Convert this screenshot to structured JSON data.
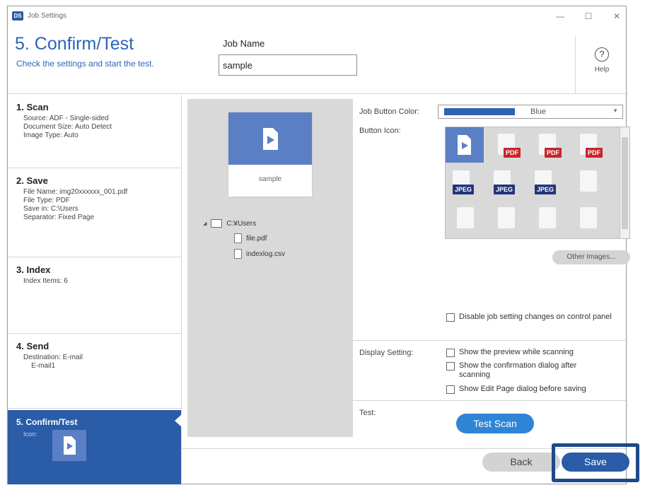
{
  "window": {
    "app_icon_text": "DS",
    "title": "Job Settings",
    "minimize": "—",
    "maximize": "☐",
    "close": "✕"
  },
  "header": {
    "step_title": "5. Confirm/Test",
    "step_subtitle": "Check the settings and start the test.",
    "job_name_label": "Job Name",
    "job_name_value": "sample",
    "help_icon": "?",
    "help_label": "Help"
  },
  "nav": {
    "items": [
      {
        "title": "1. Scan",
        "detail": "Source: ADF - Single-sided\nDocument Size: Auto Detect\nImage Type: Auto"
      },
      {
        "title": "2. Save",
        "detail": "File Name: img20xxxxxx_001.pdf\nFile Type: PDF\nSave in: C:\\Users\nSeparator: Fixed Page"
      },
      {
        "title": "3. Index",
        "detail": "Index Items: 6"
      },
      {
        "title": "4. Send",
        "detail": "Destination: E-mail\n    E-mail1"
      },
      {
        "title": "5. Confirm/Test",
        "detail": "Icon:"
      }
    ],
    "active_index": 4
  },
  "preview": {
    "job_tile_label": "sample",
    "tree": {
      "expander": "◢",
      "folder": "C:¥Users",
      "files": [
        "file.pdf",
        "indexlog.csv"
      ]
    }
  },
  "settings": {
    "job_button_color_label": "Job Button Color:",
    "job_button_color_value": "Blue",
    "job_button_color_hex": "#2f63b3",
    "button_icon_label": "Button Icon:",
    "icons": [
      {
        "icon": "play-document-icon",
        "badge": ""
      },
      {
        "icon": "play-document-icon",
        "badge": "PDF"
      },
      {
        "icon": "play-document-icon",
        "badge": "PDF"
      },
      {
        "icon": "play-document-icon",
        "badge": "PDF"
      },
      {
        "icon": "play-document-icon",
        "badge": "JPEG"
      },
      {
        "icon": "play-document-icon",
        "badge": "JPEG"
      },
      {
        "icon": "play-document-icon",
        "badge": "JPEG"
      },
      {
        "icon": "play-document-icon",
        "badge": ""
      }
    ],
    "other_images_label": "Other Images...",
    "disable_changes_label": "Disable job setting changes on control panel",
    "display_setting_label": "Display Setting:",
    "display_options": [
      "Show the preview while scanning",
      "Show the confirmation dialog after scanning",
      "Show Edit Page dialog before saving"
    ],
    "test_label": "Test:",
    "test_scan_label": "Test Scan"
  },
  "footer": {
    "back_label": "Back",
    "save_label": "Save"
  },
  "colors": {
    "accent": "#2a5ca8",
    "test_button": "#2e85d6",
    "pdf_badge": "#c9252c",
    "jpeg_badge": "#23357a",
    "highlight_frame": "#1d4a8c"
  }
}
